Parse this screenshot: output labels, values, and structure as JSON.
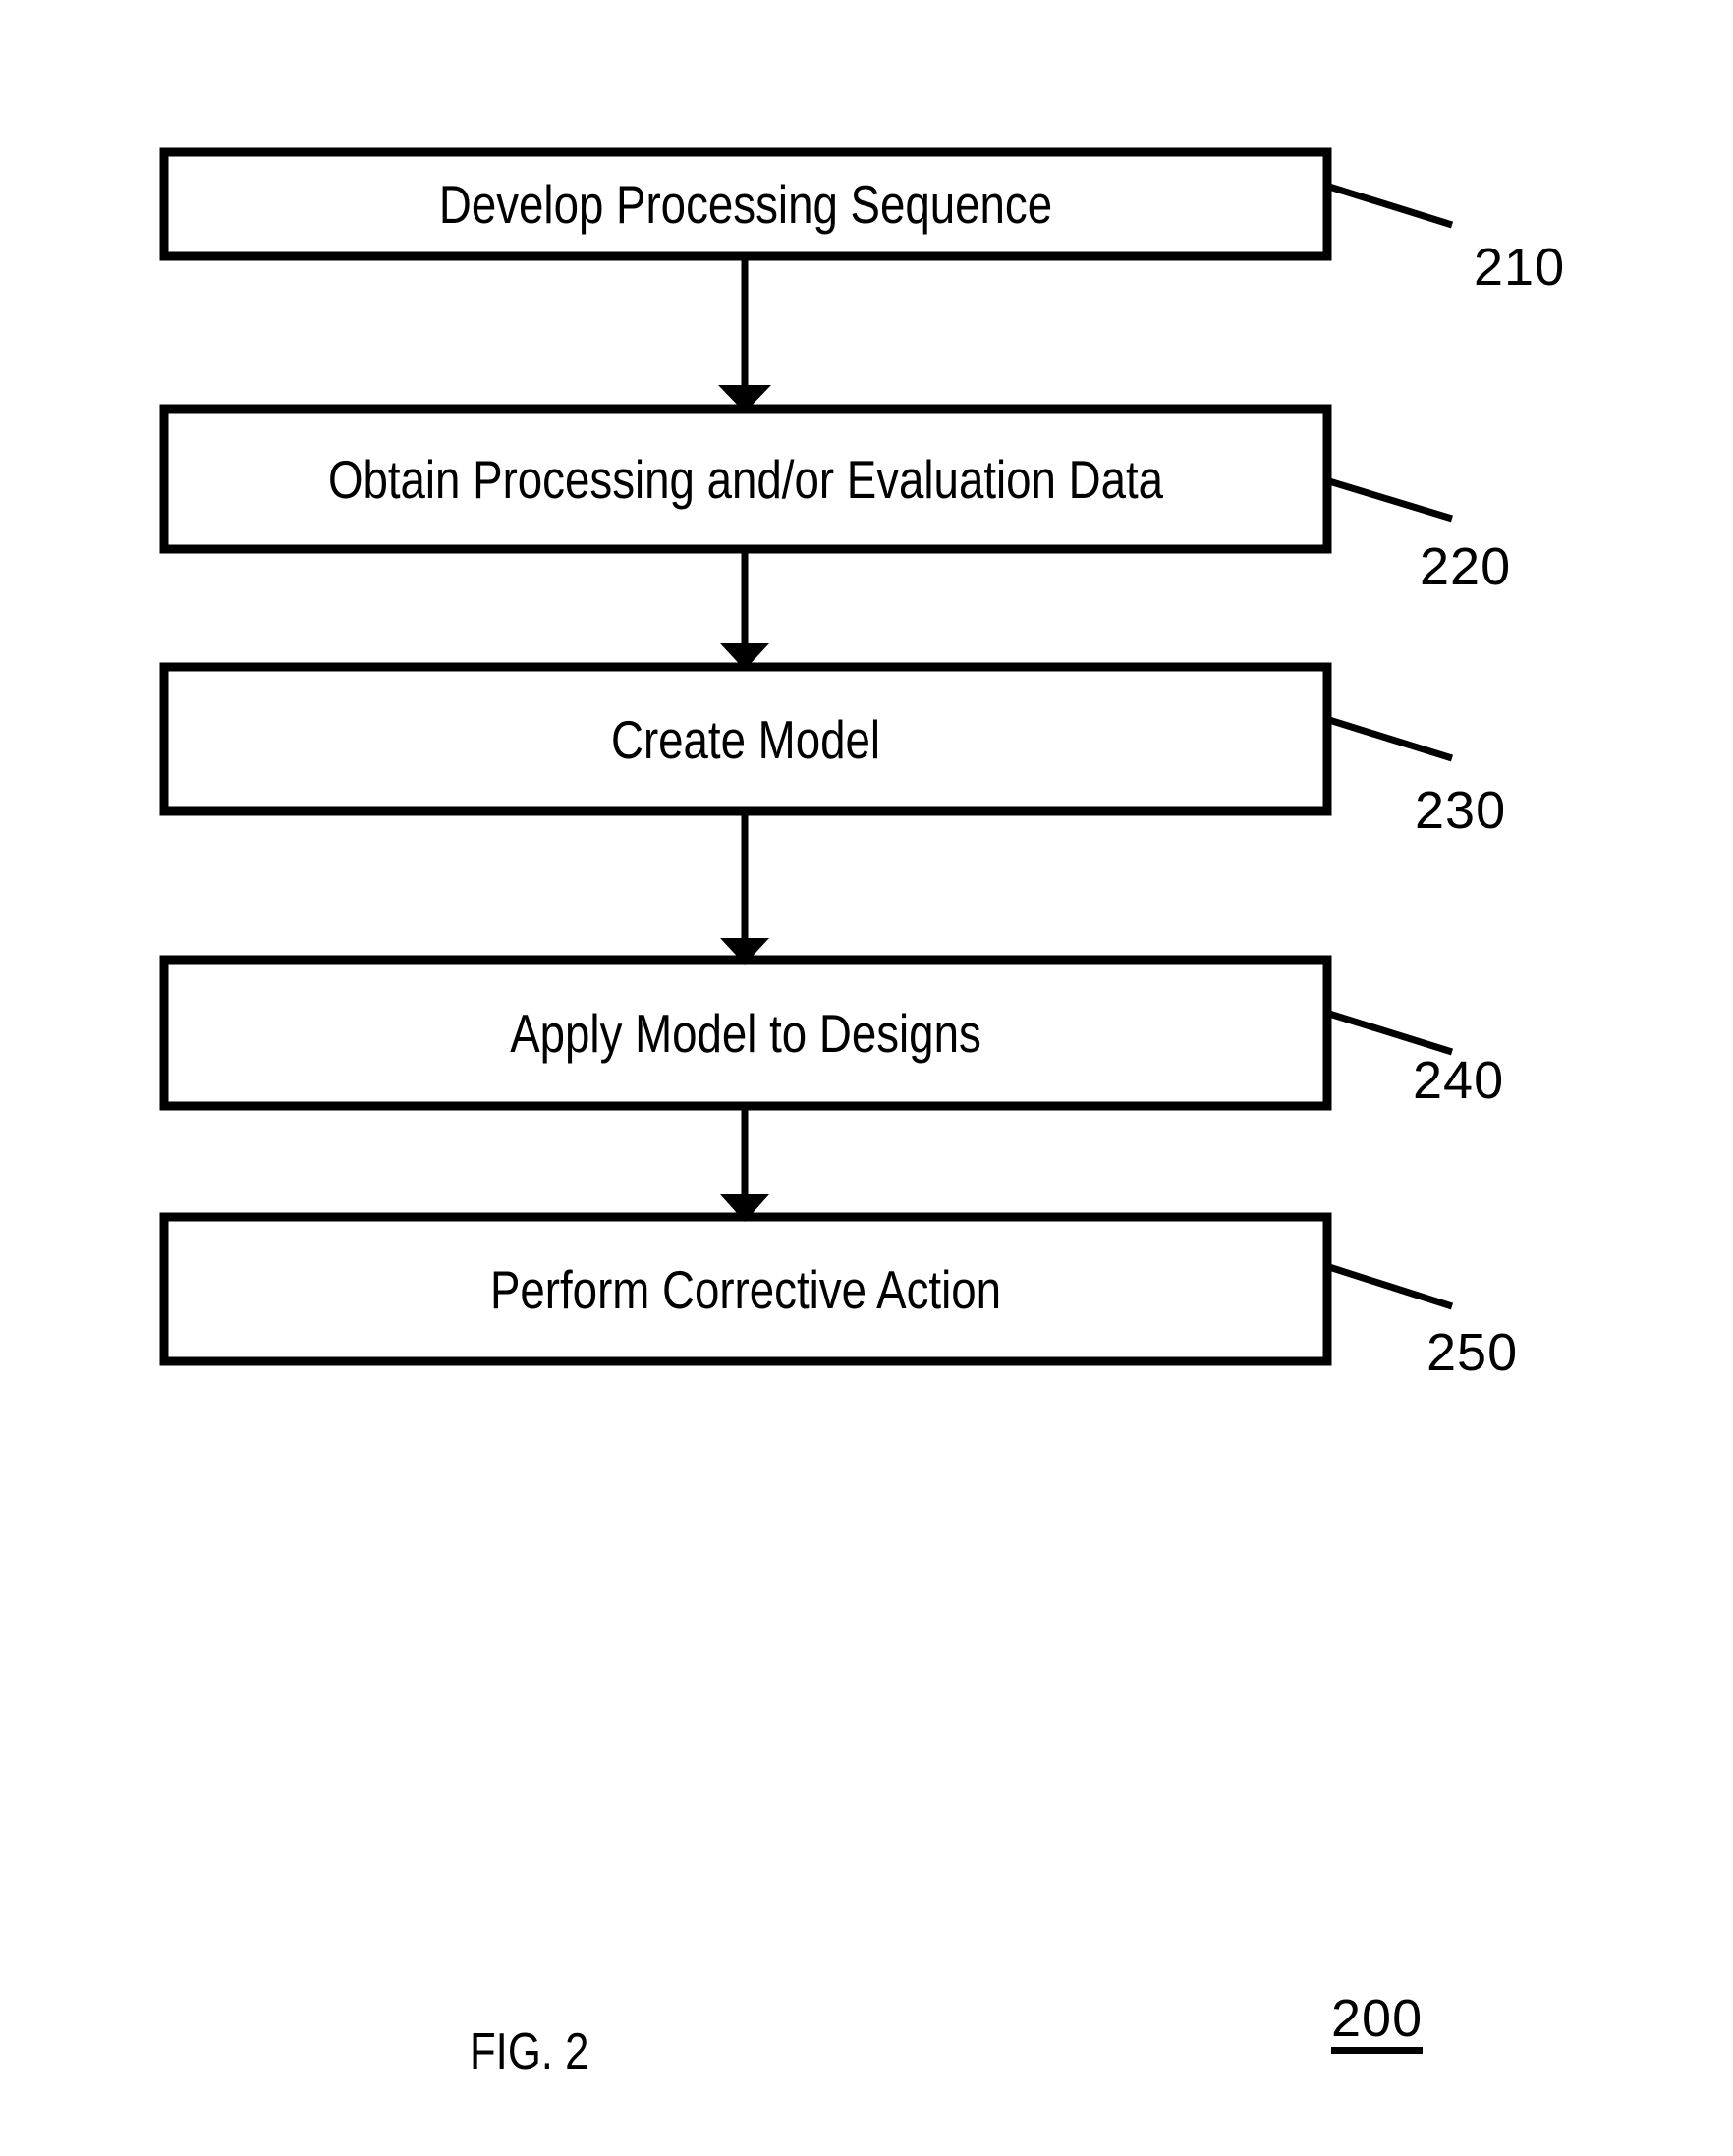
{
  "figure": {
    "caption": "FIG. 2",
    "identifier": "200",
    "background_color": "#ffffff",
    "line_color": "#000000"
  },
  "flowchart": {
    "steps": [
      {
        "ref": "210",
        "label": "Develop Processing Sequence"
      },
      {
        "ref": "220",
        "label": "Obtain Processing and/or Evaluation Data"
      },
      {
        "ref": "230",
        "label": "Create Model"
      },
      {
        "ref": "240",
        "label": "Apply Model to Designs"
      },
      {
        "ref": "250",
        "label": "Perform Corrective Action"
      }
    ],
    "connectors": [
      {
        "from": "210",
        "to": "220",
        "type": "arrow-down"
      },
      {
        "from": "220",
        "to": "230",
        "type": "arrow-down"
      },
      {
        "from": "230",
        "to": "240",
        "type": "arrow-down"
      },
      {
        "from": "240",
        "to": "250",
        "type": "arrow-down"
      }
    ]
  }
}
